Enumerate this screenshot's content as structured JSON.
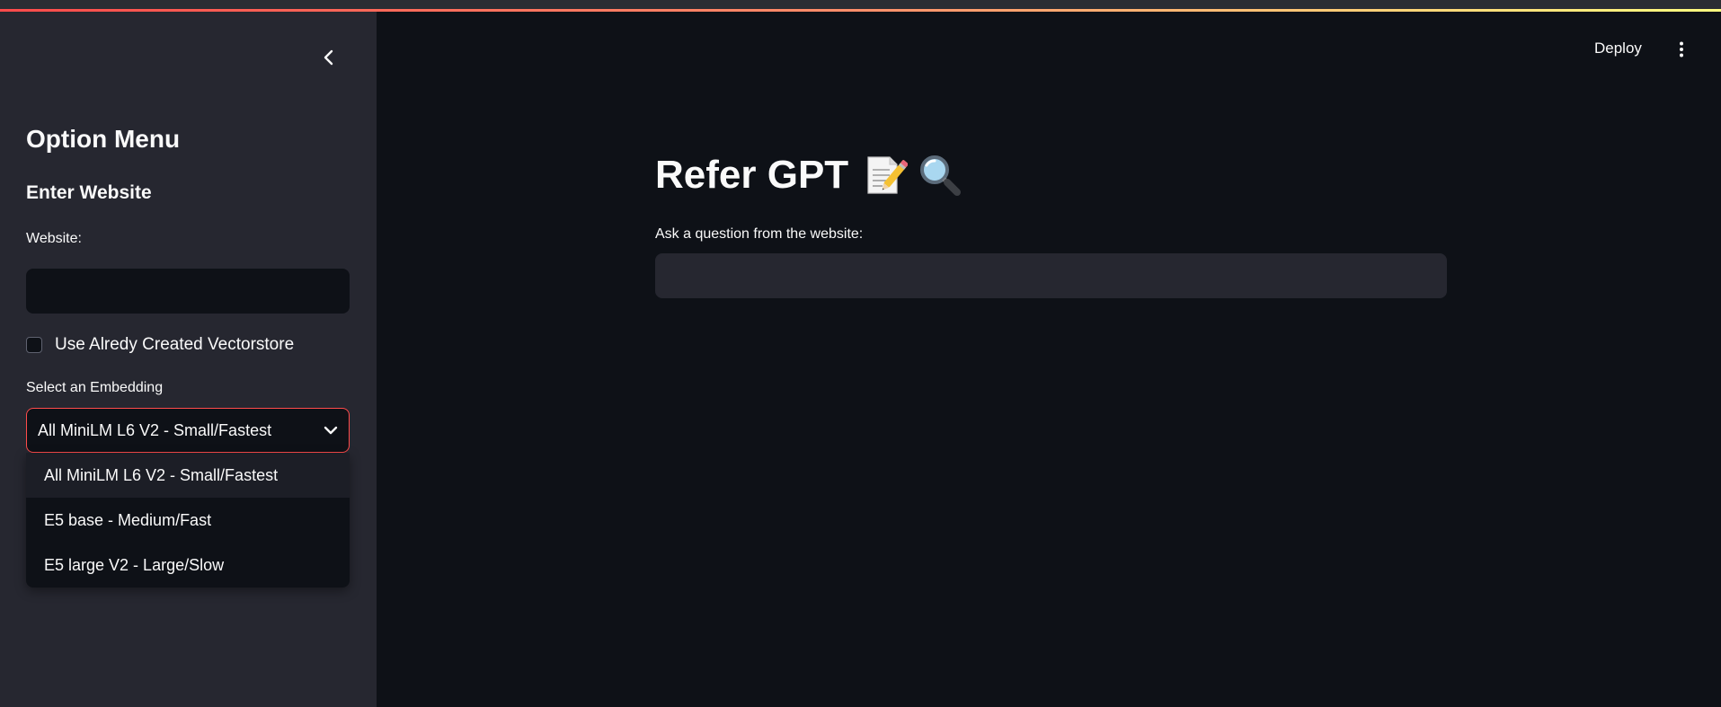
{
  "header": {
    "deploy_label": "Deploy",
    "accent_colors": [
      "#ff4b4b",
      "#fffd80"
    ]
  },
  "sidebar": {
    "title": "Option Menu",
    "subtitle": "Enter Website",
    "website_label": "Website:",
    "website_value": "",
    "checkbox_label": "Use Alredy Created Vectorstore",
    "checkbox_checked": false,
    "select_label": "Select an Embedding",
    "select_value": "All MiniLM L6 V2 - Small/Fastest",
    "options": [
      "All MiniLM L6 V2 - Small/Fastest",
      "E5 base - Medium/Fast",
      "E5 large V2 - Large/Slow"
    ]
  },
  "main": {
    "title": "Refer GPT",
    "title_icons": [
      "memo-icon",
      "magnifier-icon"
    ],
    "question_label": "Ask a question from the website:",
    "question_value": ""
  },
  "colors": {
    "background": "#0e1117",
    "sidebar": "#262730",
    "focus_border": "#ff4b4b"
  }
}
